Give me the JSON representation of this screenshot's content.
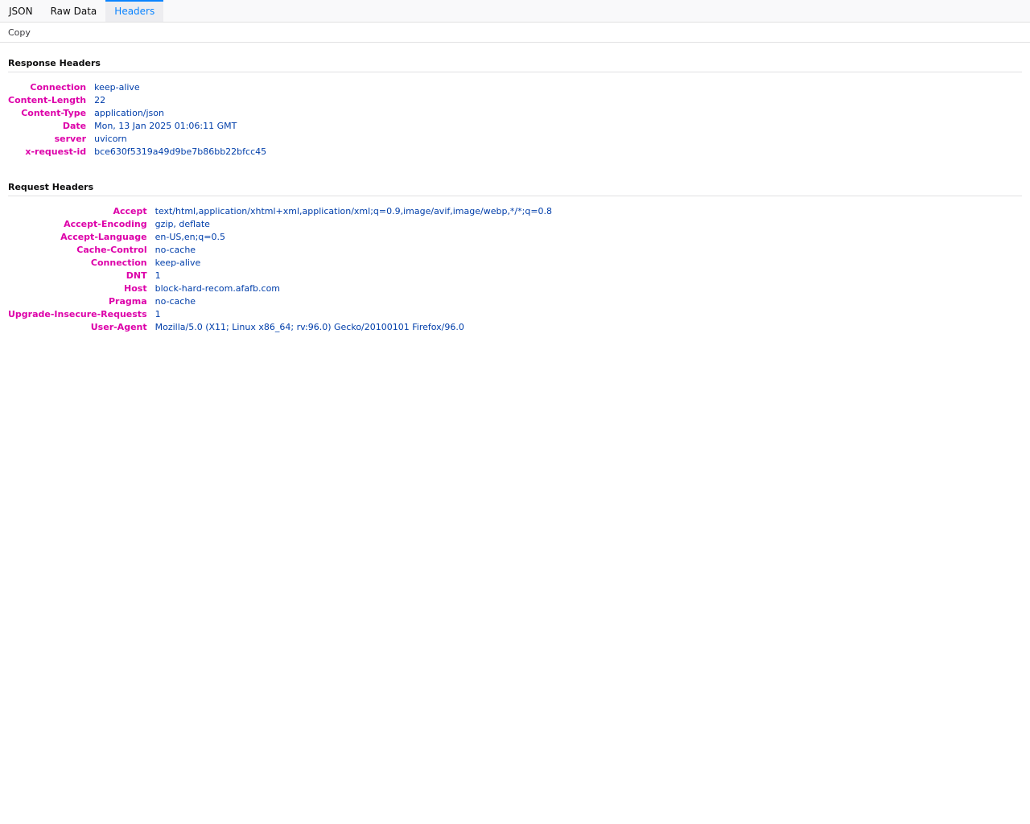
{
  "tabs": [
    {
      "label": "JSON",
      "selected": false
    },
    {
      "label": "Raw Data",
      "selected": false
    },
    {
      "label": "Headers",
      "selected": true
    }
  ],
  "toolbar": {
    "copy_label": "Copy"
  },
  "response": {
    "title": "Response Headers",
    "rows": [
      {
        "name": "Connection",
        "value": "keep-alive"
      },
      {
        "name": "Content-Length",
        "value": "22"
      },
      {
        "name": "Content-Type",
        "value": "application/json"
      },
      {
        "name": "Date",
        "value": "Mon, 13 Jan 2025 01:06:11 GMT"
      },
      {
        "name": "server",
        "value": "uvicorn"
      },
      {
        "name": "x-request-id",
        "value": "bce630f5319a49d9be7b86bb22bfcc45"
      }
    ]
  },
  "request": {
    "title": "Request Headers",
    "rows": [
      {
        "name": "Accept",
        "value": "text/html,application/xhtml+xml,application/xml;q=0.9,image/avif,image/webp,*/*;q=0.8"
      },
      {
        "name": "Accept-Encoding",
        "value": "gzip, deflate"
      },
      {
        "name": "Accept-Language",
        "value": "en-US,en;q=0.5"
      },
      {
        "name": "Cache-Control",
        "value": "no-cache"
      },
      {
        "name": "Connection",
        "value": "keep-alive"
      },
      {
        "name": "DNT",
        "value": "1"
      },
      {
        "name": "Host",
        "value": "block-hard-recom.afafb.com"
      },
      {
        "name": "Pragma",
        "value": "no-cache"
      },
      {
        "name": "Upgrade-Insecure-Requests",
        "value": "1"
      },
      {
        "name": "User-Agent",
        "value": "Mozilla/5.0 (X11; Linux x86_64; rv:96.0) Gecko/20100101 Firefox/96.0"
      }
    ]
  },
  "colors": {
    "header_name": "#dd00a9",
    "header_value": "#003eaa",
    "accent": "#0a84ff"
  }
}
